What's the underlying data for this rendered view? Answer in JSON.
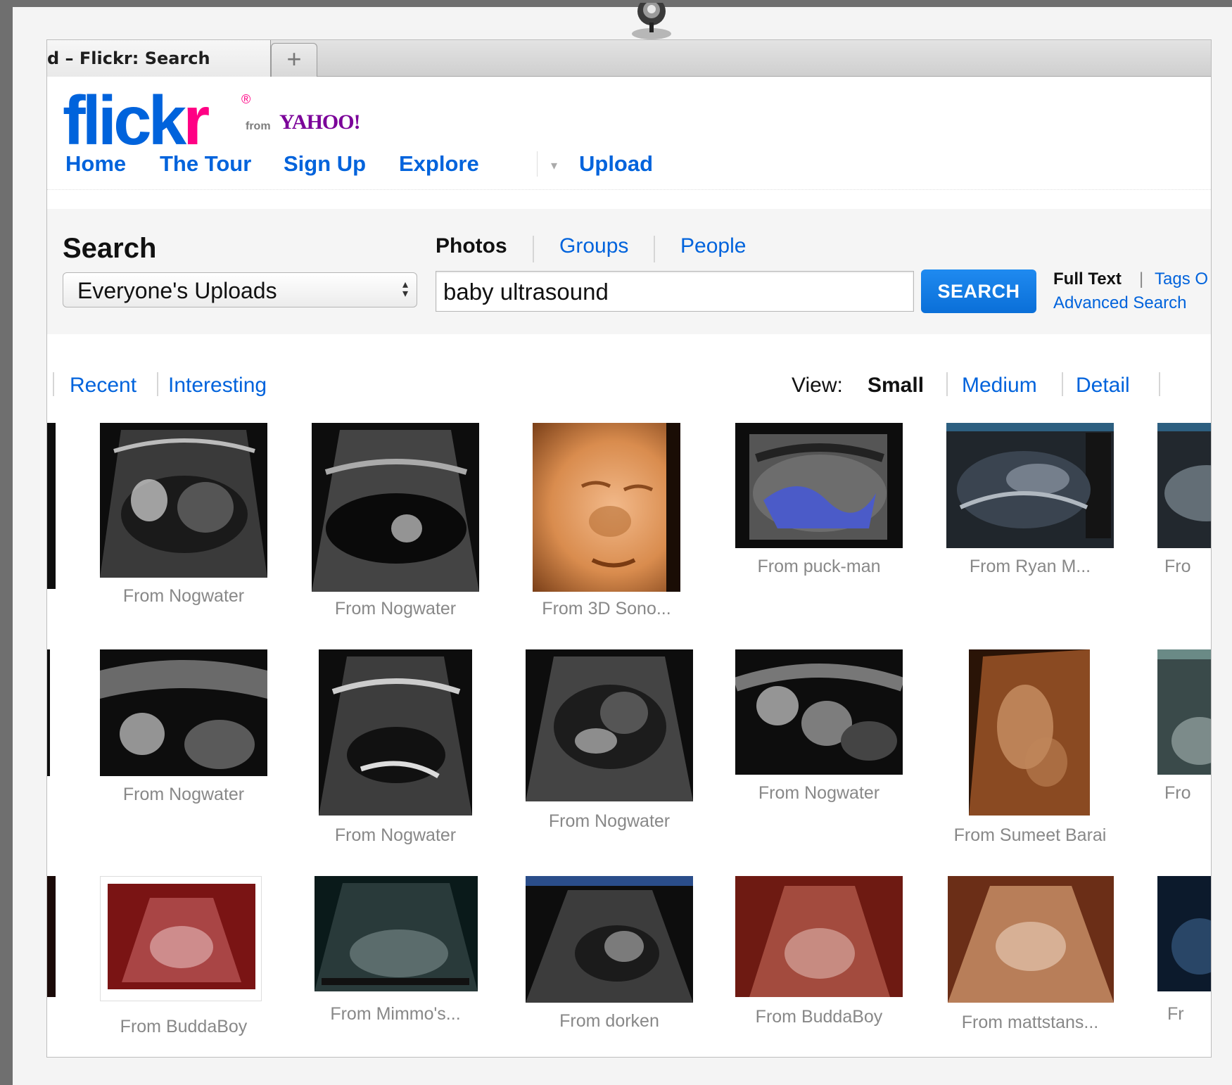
{
  "browser": {
    "tab_title": "d – Flickr: Search",
    "new_tab_label": "+"
  },
  "brand": {
    "logo_main": "flick",
    "logo_r": "r",
    "registered": "®",
    "from": "from",
    "yahoo": "YAHOO!"
  },
  "nav": {
    "home": "Home",
    "tour": "The Tour",
    "signup": "Sign Up",
    "explore": "Explore",
    "explore_caret": "▾",
    "upload": "Upload"
  },
  "search": {
    "heading": "Search",
    "tabs": {
      "photos": "Photos",
      "groups": "Groups",
      "people": "People"
    },
    "scope_value": "Everyone's Uploads",
    "query": "baby ultrasound",
    "button": "SEARCH",
    "full_text": "Full Text",
    "pipe": "|",
    "tags_only": "Tags O",
    "advanced": "Advanced Search"
  },
  "sort": {
    "recent": "Recent",
    "interesting": "Interesting"
  },
  "view": {
    "label": "View:",
    "small": "Small",
    "medium": "Medium",
    "detail": "Detail"
  },
  "results": {
    "row1": [
      "From Nogwater",
      "From Nogwater",
      "From 3D Sono...",
      "From puck-man",
      "From Ryan M...",
      "Fro"
    ],
    "row2": [
      "From Nogwater",
      "From Nogwater",
      "From Nogwater",
      "From Nogwater",
      "From Sumeet Barai",
      "Fro"
    ],
    "row3": [
      "From BuddaBoy",
      "From Mimmo's...",
      "From dorken",
      "From BuddaBoy",
      "From mattstans...",
      "Fr"
    ]
  },
  "colors": {
    "flickr_blue": "#0063dc",
    "flickr_pink": "#ff0084",
    "yahoo_purple": "#7b0099",
    "search_button": "#0a6fd8"
  }
}
